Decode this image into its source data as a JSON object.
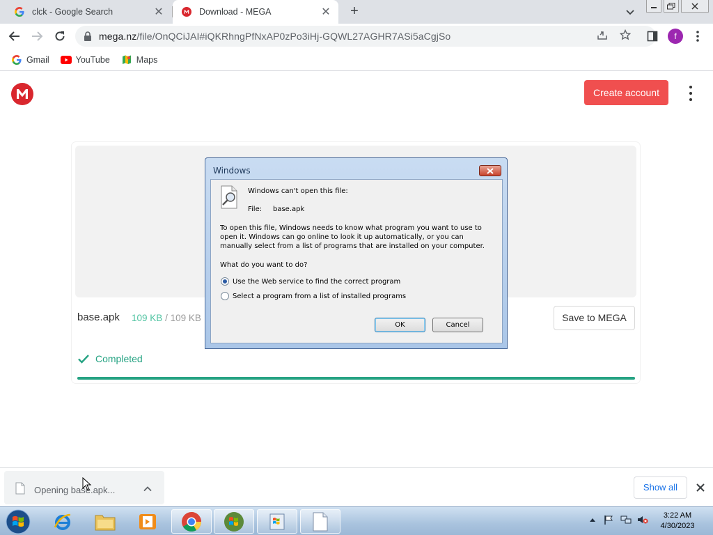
{
  "browser": {
    "tabs": [
      {
        "title": "clck - Google Search",
        "active": false
      },
      {
        "title": "Download - MEGA",
        "active": true
      }
    ],
    "url_host": "mega.nz",
    "url_path": "/file/OnQCiJAI#iQKRhngPfNxAP0zPo3iHj-GQWL27AGHR7ASi5aCgjSo",
    "profile_initial": "f",
    "bookmarks": [
      "Gmail",
      "YouTube",
      "Maps"
    ]
  },
  "mega": {
    "create_account": "Create account",
    "file_name": "base.apk",
    "downloaded": "109 KB",
    "total": "/ 109 KB",
    "save_button": "Save to MEGA",
    "status": "Completed",
    "progress_percent": 100
  },
  "dialog": {
    "title": "Windows",
    "heading": "Windows can't open this file:",
    "file_label": "File:",
    "file_value": "base.apk",
    "paragraph": "To open this file, Windows needs to know what program you want to use to open it. Windows can go online to look it up automatically, or you can manually select from a list of programs that are installed on your computer.",
    "question": "What do you want to do?",
    "options": [
      {
        "label": "Use the Web service to find the correct program",
        "selected": true
      },
      {
        "label": "Select a program from a list of installed programs",
        "selected": false
      }
    ],
    "ok": "OK",
    "cancel": "Cancel"
  },
  "downloads": {
    "item": "Opening base.apk...",
    "show_all": "Show all"
  },
  "taskbar": {
    "time": "3:22 AM",
    "date": "4/30/2023"
  },
  "colors": {
    "mega_red": "#d9272e",
    "create_btn": "#f04f4f",
    "mega_green": "#26a383",
    "profile": "#9c27b0"
  }
}
